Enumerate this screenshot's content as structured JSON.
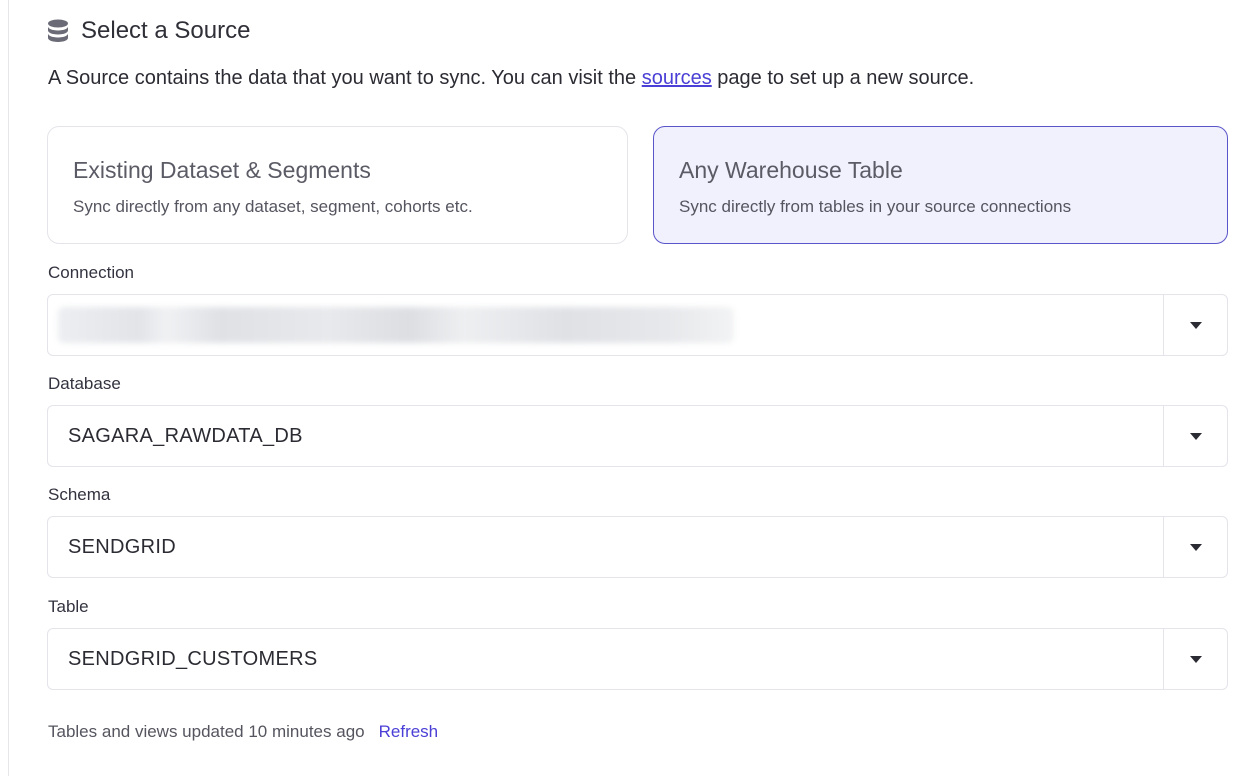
{
  "header": {
    "icon": "database-icon",
    "title": "Select a Source"
  },
  "description": {
    "before": "A Source contains the data that you want to sync. You can visit the ",
    "link": "sources",
    "after": " page to set up a new source."
  },
  "cards": [
    {
      "title": "Existing Dataset & Segments",
      "subtitle": "Sync directly from any dataset, segment, cohorts etc.",
      "selected": false
    },
    {
      "title": "Any Warehouse Table",
      "subtitle": "Sync directly from tables in your source connections",
      "selected": true
    }
  ],
  "fields": {
    "connection": {
      "label": "Connection",
      "value": ""
    },
    "database": {
      "label": "Database",
      "value": "SAGARA_RAWDATA_DB"
    },
    "schema": {
      "label": "Schema",
      "value": "SENDGRID"
    },
    "table": {
      "label": "Table",
      "value": "SENDGRID_CUSTOMERS"
    }
  },
  "footer": {
    "status": "Tables and views updated 10 minutes ago",
    "refresh": "Refresh"
  },
  "colors": {
    "accent": "#4a3fd6",
    "selected_card_bg": "#f1f1fd",
    "selected_card_border": "#5a55c9"
  }
}
